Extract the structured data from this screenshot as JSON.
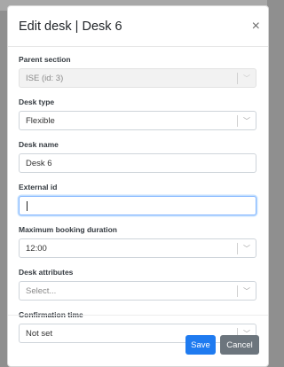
{
  "modal": {
    "title": "Edit desk | Desk 6",
    "close_icon": "close-icon"
  },
  "fields": {
    "parent_section": {
      "label": "Parent section",
      "value": "ISE (id: 3)"
    },
    "desk_type": {
      "label": "Desk type",
      "value": "Flexible"
    },
    "desk_name": {
      "label": "Desk name",
      "value": "Desk 6"
    },
    "external_id": {
      "label": "External id",
      "value": ""
    },
    "max_booking_duration": {
      "label": "Maximum booking duration",
      "value": "12:00"
    },
    "desk_attributes": {
      "label": "Desk attributes",
      "placeholder": "Select..."
    },
    "confirmation_time": {
      "label": "Confirmation time",
      "value": "Not set"
    }
  },
  "footer": {
    "save_label": "Save",
    "cancel_label": "Cancel"
  },
  "colors": {
    "primary": "#1f7bf0",
    "secondary": "#6c757d",
    "focus_border": "#7fb3ff"
  }
}
